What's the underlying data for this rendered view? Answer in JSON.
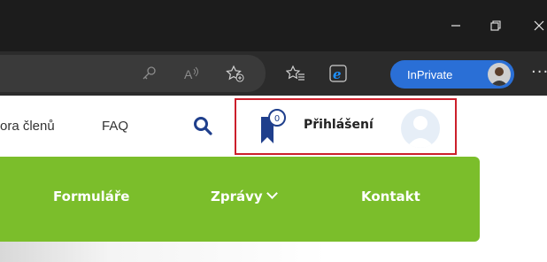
{
  "browser": {
    "window_controls": [
      "minimize",
      "restore",
      "close"
    ],
    "toolbar_icons": [
      "key-icon",
      "read-aloud-icon",
      "add-favorite-icon",
      "favorites-icon",
      "ie-mode-icon"
    ],
    "inprivate_label": "InPrivate",
    "more_label": "···"
  },
  "site": {
    "nav": {
      "podpora_label": "ora členů",
      "faq_label": "FAQ"
    },
    "login": {
      "badge_count": "0",
      "label": "Přihlášení"
    },
    "menu": {
      "items": [
        {
          "label": "Formuláře"
        },
        {
          "label": "Zprávy"
        },
        {
          "label": "Kontakt"
        }
      ]
    }
  },
  "colors": {
    "green_menu": "#7bbe2b",
    "login_border": "#cc1f2b",
    "brand_navy": "#1f3f8c",
    "inprivate_blue": "#2a6fd6"
  }
}
